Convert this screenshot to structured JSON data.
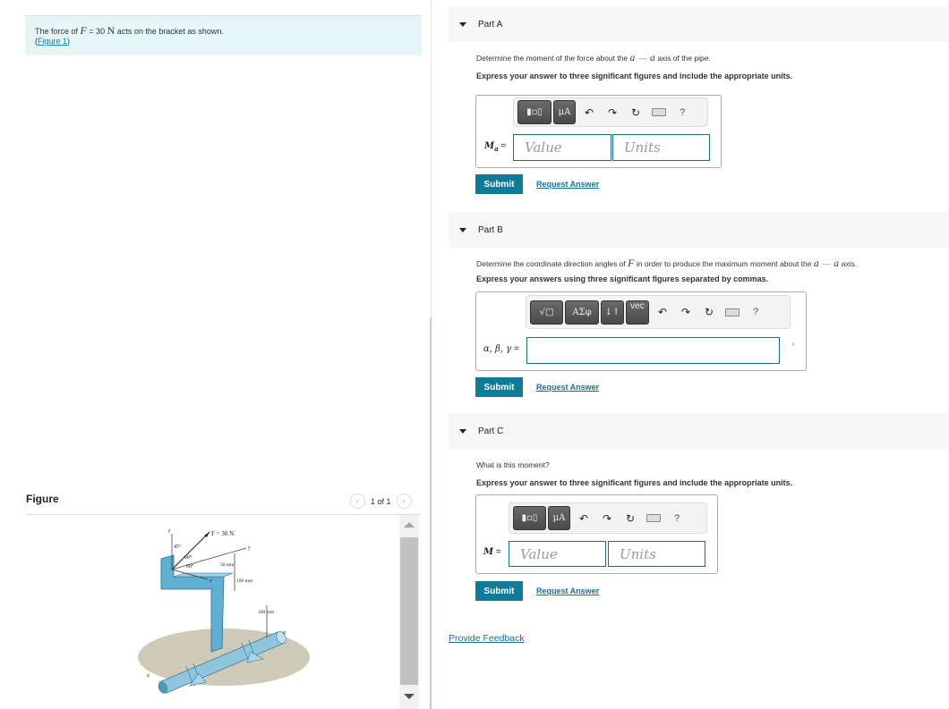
{
  "intro": {
    "prefix": "The force of ",
    "var": "F",
    "eq": " = 30 ",
    "unit": "N",
    "suffix": " acts on the bracket as shown.",
    "figure_link": "Figure 1",
    "open_paren": "(",
    "close_paren": ")"
  },
  "figure_panel": {
    "title": "Figure",
    "counter": "1 of 1",
    "prev_icon": "chevron-left-icon",
    "next_icon": "chevron-right-icon",
    "labels": {
      "force": "F = 30 N",
      "z": "z",
      "y": "y",
      "x": "x",
      "a": "a",
      "angle_45": "45°",
      "angle_60a": "60°",
      "angle_60b": "60°",
      "dim_50": "50 mm",
      "dim_100a": "100 mm",
      "dim_100b": "100 mm"
    }
  },
  "toolbar_common": {
    "undo": "↶",
    "redo": "↷",
    "reset": "↻",
    "help": "?"
  },
  "parts": [
    {
      "label": "Part A",
      "question_prefix": "Determine the moment of the force about the ",
      "axis_a1": "a",
      "dash": "—",
      "axis_a2": "a",
      "question_suffix": " axis of the pipe.",
      "instruction": "Express your answer to three significant figures and include the appropriate units.",
      "toolbar_buttons": [
        "templates",
        "μA"
      ],
      "eq_var": "M",
      "eq_sub": "a",
      "eq_sign": " =",
      "value_placeholder": "Value",
      "units_placeholder": "Units",
      "submit": "Submit",
      "request": "Request Answer"
    },
    {
      "label": "Part B",
      "question_prefix": "Determine the coordinate direction angles of ",
      "var": "F",
      "question_mid": " in order to produce the maximum moment about the ",
      "axis_a1": "a",
      "dash": "—",
      "axis_a2": "a",
      "question_suffix": " axis.",
      "instruction": "Express your answers using three significant figures separated by commas.",
      "toolbar_buttons": [
        "√□",
        "ΑΣφ",
        "↓↑",
        "vec"
      ],
      "eq_label": "α, β, γ",
      "eq_sign": " =",
      "value": "",
      "unit_symbol": "°",
      "submit": "Submit",
      "request": "Request Answer"
    },
    {
      "label": "Part C",
      "question": "What is this moment?",
      "instruction": "Express your answer to three significant figures and include the appropriate units.",
      "toolbar_buttons": [
        "templates",
        "μA"
      ],
      "eq_var": "M",
      "eq_sign": " =",
      "value_placeholder": "Value",
      "units_placeholder": "Units",
      "submit": "Submit",
      "request": "Request Answer"
    }
  ],
  "feedback": "Provide Feedback",
  "colors": {
    "accent": "#0e7c99",
    "link": "#1a6e94",
    "intro_bg": "#e6f5f6",
    "input_border": "#1b6f86"
  }
}
